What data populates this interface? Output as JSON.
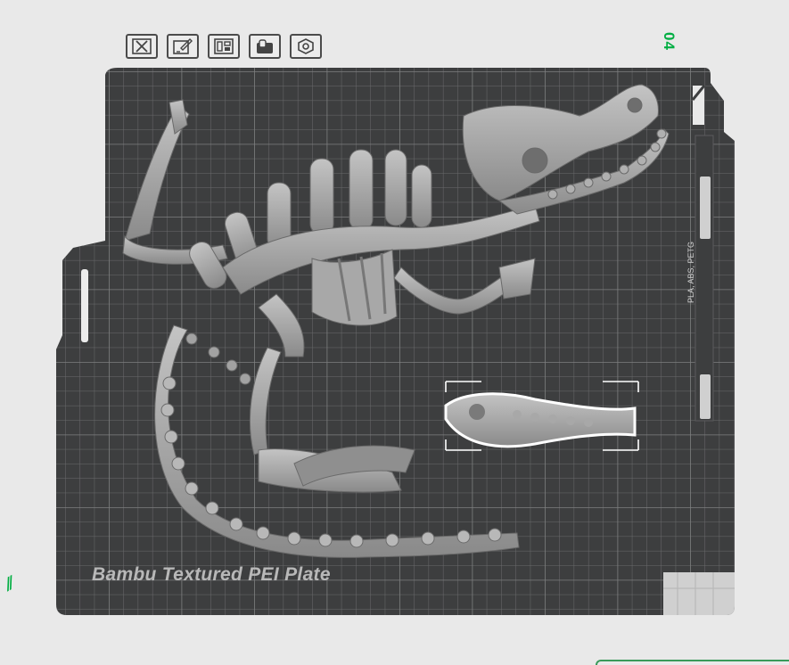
{
  "toolbar": {
    "buttons": [
      {
        "name": "delete-icon"
      },
      {
        "name": "edit-plate-icon"
      },
      {
        "name": "arrange-icon"
      },
      {
        "name": "lock-icon"
      },
      {
        "name": "settings-icon"
      }
    ]
  },
  "plate": {
    "number": "04",
    "label": "Bambu Textured PEI Plate",
    "side_text": "PLA, ABS, PETG",
    "selected_object": "fish-skeleton-part"
  },
  "colors": {
    "accent": "#00ae42",
    "plate": "#3d3e3f",
    "grid": "#5a5b5c",
    "model": "#9c9c9c",
    "background": "#e9e9e9"
  }
}
